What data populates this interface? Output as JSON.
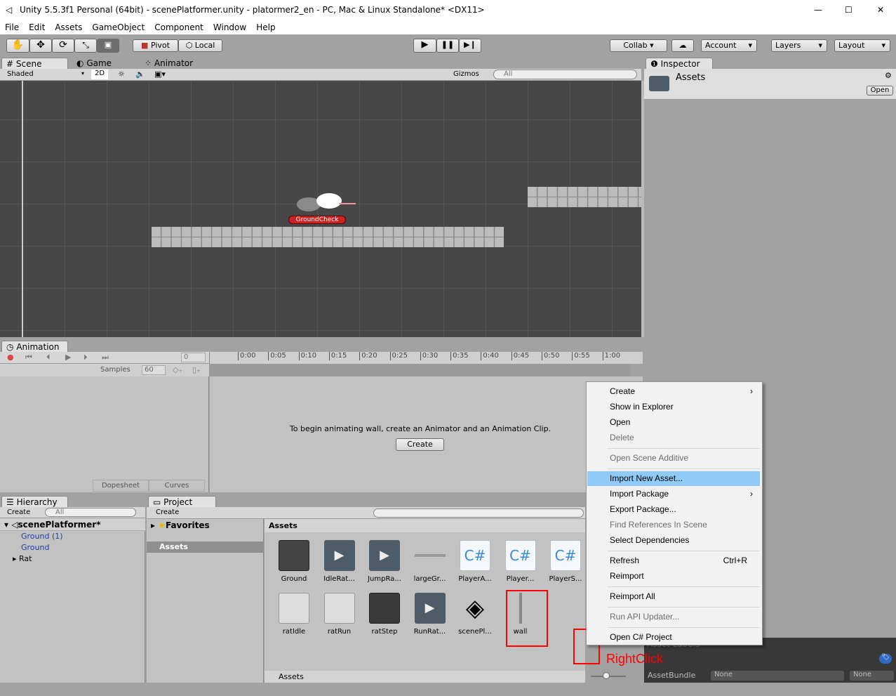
{
  "title": "Unity 5.5.3f1 Personal (64bit) - scenePlatformer.unity - platormer2_en - PC, Mac & Linux Standalone* <DX11>",
  "menubar": [
    "File",
    "Edit",
    "Assets",
    "GameObject",
    "Component",
    "Window",
    "Help"
  ],
  "toolbar": {
    "pivot": "Pivot",
    "local": "Local",
    "collab": "Collab ▾",
    "account": "Account",
    "layers": "Layers",
    "layout": "Layout"
  },
  "scene": {
    "tabs": [
      "Scene",
      "Game",
      "Animator"
    ],
    "shaded": "Shaded",
    "mode2d": "2D",
    "gizmos": "Gizmos",
    "search_placeholder": "All",
    "ground_check": "GroundCheck"
  },
  "inspector": {
    "tab": "Inspector",
    "name": "Assets",
    "open": "Open",
    "labels_header": "Asset Labels",
    "assetbundle_label": "AssetBundle",
    "bundle_value": "None",
    "variant_value": "None"
  },
  "animation": {
    "tab": "Animation",
    "frame": "0",
    "samples_label": "Samples",
    "samples": "60",
    "ticks": [
      "0:00",
      "0:05",
      "0:10",
      "0:15",
      "0:20",
      "0:25",
      "0:30",
      "0:35",
      "0:40",
      "0:45",
      "0:50",
      "0:55",
      "1:00"
    ],
    "message": "To begin animating wall, create an Animator and an Animation Clip.",
    "create": "Create",
    "dopesheet": "Dopesheet",
    "curves": "Curves"
  },
  "hierarchy": {
    "tab": "Hierarchy",
    "create": "Create",
    "search": "All",
    "scene": "scenePlatformer*",
    "items": [
      "Ground (1)",
      "Ground",
      "Rat"
    ]
  },
  "project": {
    "tab": "Project",
    "create": "Create",
    "favorites": "Favorites",
    "assets_folder": "Assets",
    "header": "Assets",
    "footer": "Assets",
    "assets": [
      {
        "name": "Ground",
        "type": "sprite"
      },
      {
        "name": "IdleRat...",
        "type": "anim"
      },
      {
        "name": "JumpRa...",
        "type": "anim"
      },
      {
        "name": "largeGr...",
        "type": "prefab"
      },
      {
        "name": "PlayerA...",
        "type": "cs"
      },
      {
        "name": "Player...",
        "type": "cs"
      },
      {
        "name": "PlayerS...",
        "type": "cs"
      },
      {
        "name": "ratIdle",
        "type": "sheet"
      },
      {
        "name": "ratRun",
        "type": "sheet"
      },
      {
        "name": "ratStep",
        "type": "audio"
      },
      {
        "name": "RunRat...",
        "type": "anim"
      },
      {
        "name": "scenePl...",
        "type": "unity"
      },
      {
        "name": "wall",
        "type": "prefab-v"
      }
    ]
  },
  "context_menu": [
    {
      "label": "Create",
      "submenu": true
    },
    {
      "label": "Show in Explorer"
    },
    {
      "label": "Open"
    },
    {
      "label": "Delete",
      "disabled": true
    },
    {
      "sep": true
    },
    {
      "label": "Open Scene Additive",
      "disabled": true
    },
    {
      "sep": true
    },
    {
      "label": "Import New Asset...",
      "highlighted": true
    },
    {
      "label": "Import Package",
      "submenu": true
    },
    {
      "label": "Export Package..."
    },
    {
      "label": "Find References In Scene",
      "disabled": true
    },
    {
      "label": "Select Dependencies"
    },
    {
      "sep": true
    },
    {
      "label": "Refresh",
      "shortcut": "Ctrl+R"
    },
    {
      "label": "Reimport"
    },
    {
      "sep": true
    },
    {
      "label": "Reimport All"
    },
    {
      "sep": true
    },
    {
      "label": "Run API Updater...",
      "disabled": true
    },
    {
      "sep": true
    },
    {
      "label": "Open C# Project"
    }
  ],
  "annotation": "RightClick",
  "colors": {
    "highlight": "#91c9f7",
    "annotation": "#ff0000",
    "hierarchy_link": "#1a3fa6"
  }
}
